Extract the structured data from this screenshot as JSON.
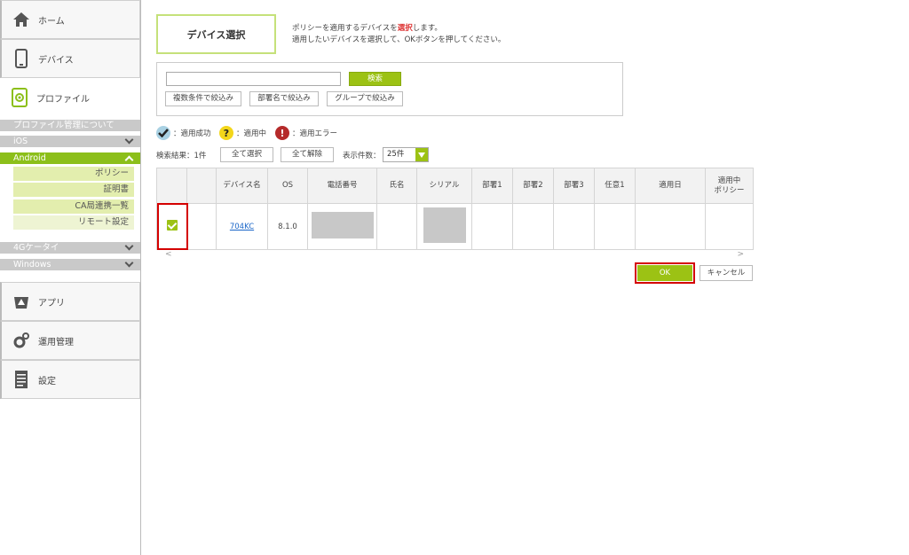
{
  "sidebar": {
    "home": "ホーム",
    "device": "デバイス",
    "profile": "プロファイル",
    "profile_sub": {
      "about": "プロファイル管理について",
      "ios": "iOS",
      "android": "Android",
      "android_items": [
        "ポリシー",
        "証明書",
        "CA局連携一覧",
        "リモート設定"
      ],
      "keitai": "4Gケータイ",
      "windows": "Windows"
    },
    "app": "アプリ",
    "operation": "運用管理",
    "settings": "設定"
  },
  "page": {
    "title": "デバイス選択",
    "desc_line1_a": "ポリシーを適用するデバイスを",
    "desc_line1_red": "選択",
    "desc_line1_b": "します。",
    "desc_line2": "適用したいデバイスを選択して、OKボタンを押してください。"
  },
  "search": {
    "value": "",
    "placeholder": "",
    "button": "検索",
    "filters": [
      "複数条件で絞込み",
      "部署名で絞込み",
      "グループで絞込み"
    ]
  },
  "legend": {
    "success": "：適用成功",
    "pending": "：適用中",
    "error": "：適用エラー"
  },
  "results": {
    "label": "検索結果：1件",
    "select_all": "全て選択",
    "deselect_all": "全て解除",
    "per_page_label": "表示件数：",
    "per_page_value": "25件"
  },
  "table": {
    "headers": [
      "",
      "",
      "デバイス名",
      "OS",
      "電話番号",
      "氏名",
      "シリアル",
      "部署1",
      "部署2",
      "部署3",
      "任意1",
      "適用日",
      "適用中\nポリシー"
    ],
    "rows": [
      {
        "checked": true,
        "status": "",
        "device_name": "704KC",
        "os": "8.1.0",
        "phone": "",
        "name": "",
        "serial": "",
        "dept1": "",
        "dept2": "",
        "dept3": "",
        "opt1": "",
        "applied_date": "",
        "policy": ""
      }
    ]
  },
  "actions": {
    "ok": "OK",
    "cancel": "キャンセル"
  },
  "colors": {
    "accent": "#9cc214",
    "highlight": "#d40000"
  }
}
